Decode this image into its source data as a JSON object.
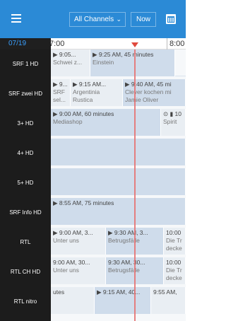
{
  "topbar": {
    "channels_label": "All Channels",
    "now_label": "Now"
  },
  "timeline": {
    "date": "07/19",
    "time_start": "7:00",
    "time_end": "8:00"
  },
  "channels": [
    {
      "label": "SRF 1 HD"
    },
    {
      "label": "SRF zwei HD"
    },
    {
      "label": "3+ HD"
    },
    {
      "label": "4+ HD"
    },
    {
      "label": "5+ HD"
    },
    {
      "label": "SRF Info HD"
    },
    {
      "label": "RTL"
    },
    {
      "label": "RTL CH HD"
    },
    {
      "label": "RTL nitro"
    }
  ],
  "rows": [
    {
      "cells": [
        {
          "a": "▶ 9:05...",
          "b": "Schwei z..."
        },
        {
          "a": "▶ 9:25 AM, 45 minutes",
          "b": "Einstein"
        }
      ]
    },
    {
      "cells": [
        {
          "a": "▶ 9...",
          "b": "SRF sel..."
        },
        {
          "a": "▶ 9:15 AM...",
          "b": "Argentinia Rustica"
        },
        {
          "a": "▶ 9:40 AM, 45 mi",
          "b": "Clever kochen mi Jamie Oliver"
        }
      ]
    },
    {
      "cells": [
        {
          "a": "▶ 9:00 AM, 60 minutes",
          "b": "Mediashop"
        },
        {
          "a": "⊙ ▮ 10",
          "b": "Spirit"
        }
      ]
    },
    {
      "cells": []
    },
    {
      "cells": []
    },
    {
      "cells": [
        {
          "a": "▶ 8:55 AM, 75 minutes",
          "b": ""
        }
      ]
    },
    {
      "cells": [
        {
          "a": "▶ 9:00 AM, 3...",
          "b": "Unter uns"
        },
        {
          "a": "▶ 9:30 AM, 3...",
          "b": "Betrugsfälle"
        },
        {
          "a": "10:00",
          "b": "Die Tr decke"
        }
      ]
    },
    {
      "cells": [
        {
          "a": "9:00 AM, 30...",
          "b": "Unter uns"
        },
        {
          "a": "9:30 AM, 30...",
          "b": "Betrugsfälle"
        },
        {
          "a": "10:00",
          "b": "Die Tr decke"
        }
      ]
    },
    {
      "cells": [
        {
          "a": "utes",
          "b": ""
        },
        {
          "a": "▶ 9:15 AM, 40...",
          "b": ""
        },
        {
          "a": "9:55 AM,",
          "b": ""
        }
      ]
    }
  ]
}
